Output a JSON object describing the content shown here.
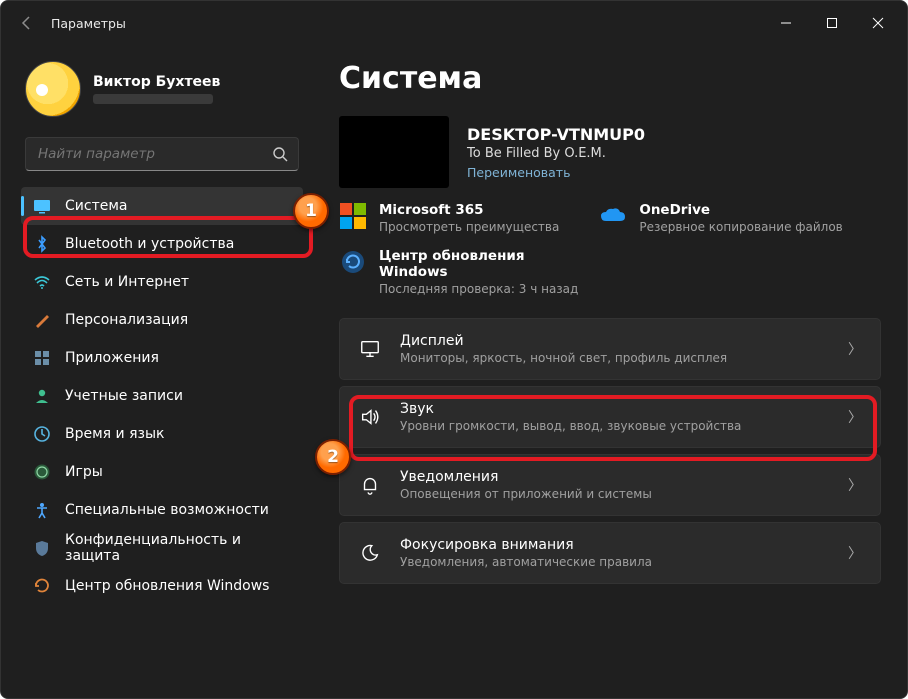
{
  "window": {
    "title": "Параметры"
  },
  "user": {
    "name": "Виктор Бухтеев"
  },
  "search": {
    "placeholder": "Найти параметр"
  },
  "sidebar": {
    "items": [
      {
        "id": "system",
        "label": "Система"
      },
      {
        "id": "bluetooth",
        "label": "Bluetooth и устройства"
      },
      {
        "id": "network",
        "label": "Сеть и Интернет"
      },
      {
        "id": "personalization",
        "label": "Персонализация"
      },
      {
        "id": "apps",
        "label": "Приложения"
      },
      {
        "id": "accounts",
        "label": "Учетные записи"
      },
      {
        "id": "time",
        "label": "Время и язык"
      },
      {
        "id": "gaming",
        "label": "Игры"
      },
      {
        "id": "accessibility",
        "label": "Специальные возможности"
      },
      {
        "id": "privacy",
        "label": "Конфиденциальность и защита"
      },
      {
        "id": "update",
        "label": "Центр обновления Windows"
      }
    ]
  },
  "page": {
    "title": "Система"
  },
  "device": {
    "name": "DESKTOP-VTNMUP0",
    "sub": "To Be Filled By O.E.M.",
    "rename": "Переименовать"
  },
  "cards": {
    "ms365": {
      "title": "Microsoft 365",
      "sub": "Просмотреть преимущества"
    },
    "onedrive": {
      "title": "OneDrive",
      "sub": "Резервное копирование файлов"
    },
    "update": {
      "title": "Центр обновления Windows",
      "sub": "Последняя проверка: 3 ч назад"
    }
  },
  "settings": [
    {
      "id": "display",
      "title": "Дисплей",
      "sub": "Мониторы, яркость, ночной свет, профиль дисплея"
    },
    {
      "id": "sound",
      "title": "Звук",
      "sub": "Уровни громкости, вывод, ввод, звуковые устройства"
    },
    {
      "id": "notifications",
      "title": "Уведомления",
      "sub": "Оповещения от приложений и системы"
    },
    {
      "id": "focus",
      "title": "Фокусировка внимания",
      "sub": "Уведомления, автоматические правила"
    }
  ],
  "markers": {
    "one": "1",
    "two": "2"
  }
}
